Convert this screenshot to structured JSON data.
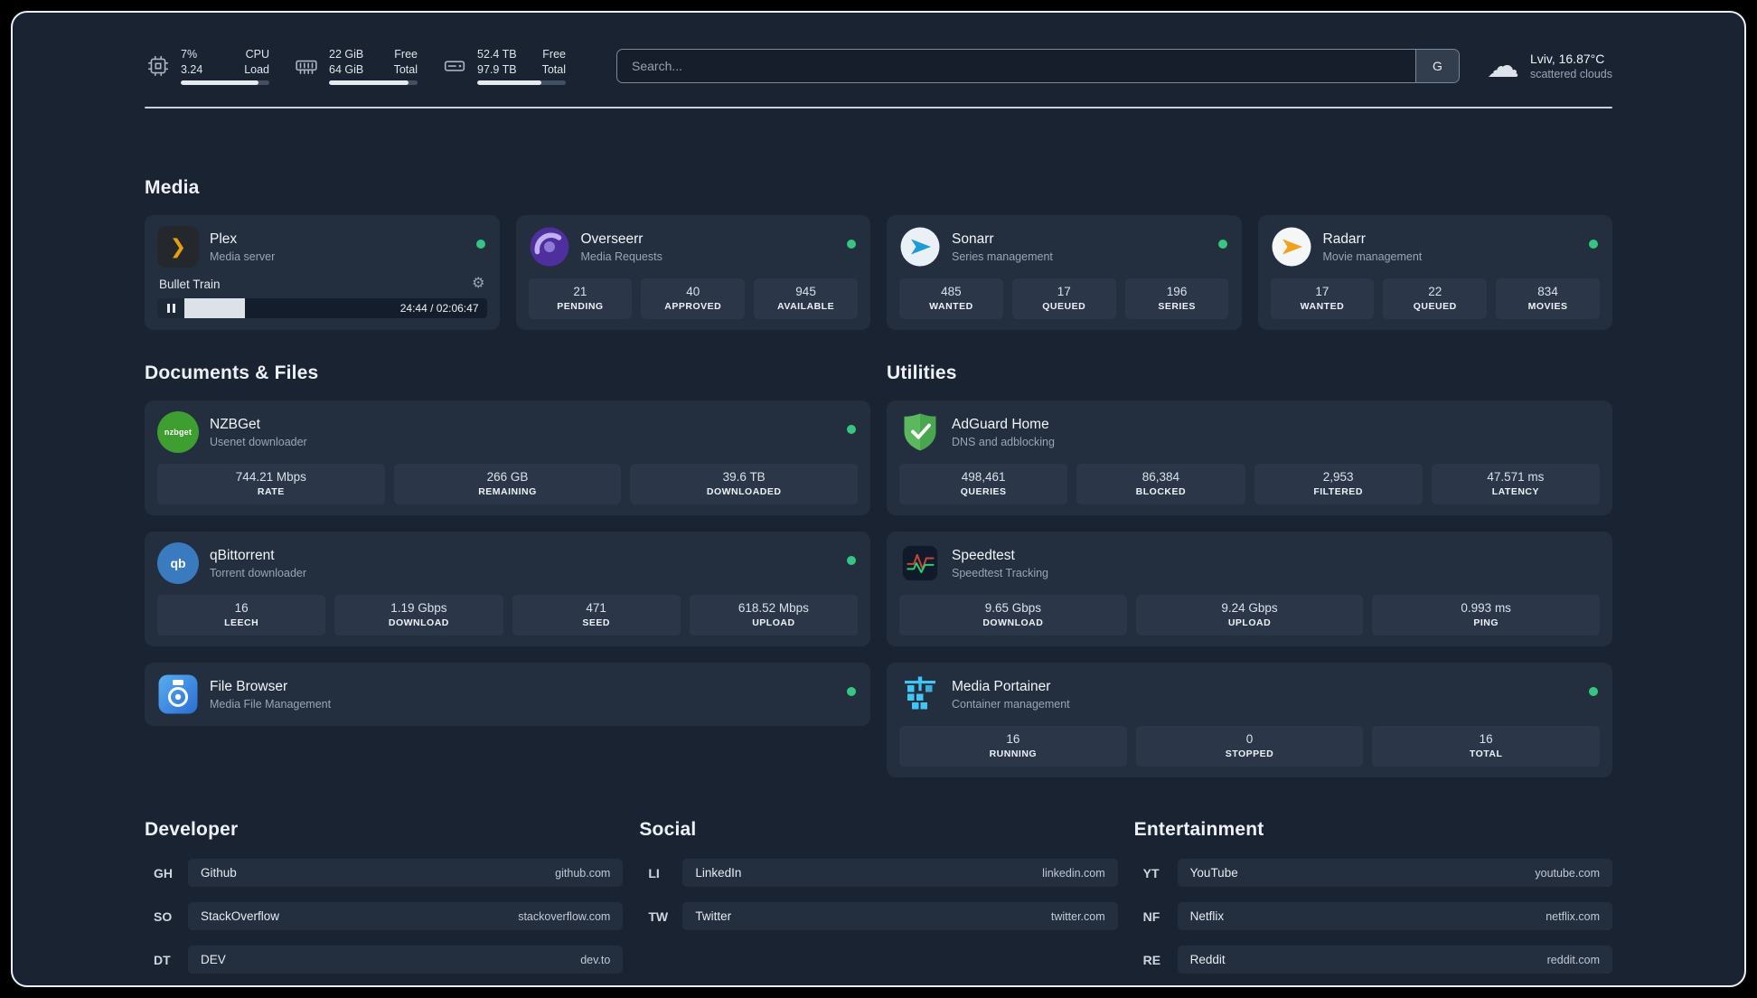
{
  "icons": {
    "plex_chevron": "❯",
    "gear": "⚙",
    "cloud": "☁"
  },
  "colors": {
    "background": "#1a2332",
    "card": "#232e3f",
    "stat_block": "#2b3748",
    "status_green": "#35c77f",
    "plex_gold": "#e5a00d"
  },
  "topbar": {
    "resources": [
      {
        "line1_value": "7%",
        "line1_label": "CPU",
        "line2_value": "3.24",
        "line2_label": "Load",
        "progress_pct": 88
      },
      {
        "line1_value": "22 GiB",
        "line1_label": "Free",
        "line2_value": "64 GiB",
        "line2_label": "Total",
        "progress_pct": 90
      },
      {
        "line1_value": "52.4 TB",
        "line1_label": "Free",
        "line2_value": "97.9 TB",
        "line2_label": "Total",
        "progress_pct": 72
      }
    ],
    "search": {
      "placeholder": "Search...",
      "provider_button": "G"
    },
    "weather": {
      "location": "Lviv, 16.87°C",
      "condition": "scattered clouds"
    }
  },
  "sections": {
    "media": {
      "title": "Media",
      "services": [
        {
          "name": "Plex",
          "description": "Media server",
          "status": "online",
          "player": {
            "track": "Bullet Train",
            "time_display": "24:44 / 02:06:47",
            "progress_pct": 20
          }
        },
        {
          "name": "Overseerr",
          "description": "Media Requests",
          "status": "online",
          "stats": [
            {
              "value": "21",
              "label": "PENDING"
            },
            {
              "value": "40",
              "label": "APPROVED"
            },
            {
              "value": "945",
              "label": "AVAILABLE"
            }
          ]
        },
        {
          "name": "Sonarr",
          "description": "Series management",
          "status": "online",
          "stats": [
            {
              "value": "485",
              "label": "WANTED"
            },
            {
              "value": "17",
              "label": "QUEUED"
            },
            {
              "value": "196",
              "label": "SERIES"
            }
          ]
        },
        {
          "name": "Radarr",
          "description": "Movie management",
          "status": "online",
          "stats": [
            {
              "value": "17",
              "label": "WANTED"
            },
            {
              "value": "22",
              "label": "QUEUED"
            },
            {
              "value": "834",
              "label": "MOVIES"
            }
          ]
        }
      ]
    },
    "documents": {
      "title": "Documents & Files",
      "services": [
        {
          "name": "NZBGet",
          "description": "Usenet downloader",
          "status": "online",
          "icon_text": "nzbget",
          "stats": [
            {
              "value": "744.21 Mbps",
              "label": "RATE"
            },
            {
              "value": "266 GB",
              "label": "REMAINING"
            },
            {
              "value": "39.6 TB",
              "label": "DOWNLOADED"
            }
          ]
        },
        {
          "name": "qBittorrent",
          "description": "Torrent downloader",
          "status": "online",
          "icon_text": "qb",
          "stats": [
            {
              "value": "16",
              "label": "LEECH"
            },
            {
              "value": "1.19 Gbps",
              "label": "DOWNLOAD"
            },
            {
              "value": "471",
              "label": "SEED"
            },
            {
              "value": "618.52 Mbps",
              "label": "UPLOAD"
            }
          ]
        },
        {
          "name": "File Browser",
          "description": "Media File Management",
          "status": "online",
          "stats": []
        }
      ]
    },
    "utilities": {
      "title": "Utilities",
      "services": [
        {
          "name": "AdGuard Home",
          "description": "DNS and adblocking",
          "stats": [
            {
              "value": "498,461",
              "label": "QUERIES"
            },
            {
              "value": "86,384",
              "label": "BLOCKED"
            },
            {
              "value": "2,953",
              "label": "FILTERED"
            },
            {
              "value": "47.571 ms",
              "label": "LATENCY"
            }
          ]
        },
        {
          "name": "Speedtest",
          "description": "Speedtest Tracking",
          "stats": [
            {
              "value": "9.65 Gbps",
              "label": "DOWNLOAD"
            },
            {
              "value": "9.24 Gbps",
              "label": "UPLOAD"
            },
            {
              "value": "0.993 ms",
              "label": "PING"
            }
          ]
        },
        {
          "name": "Media Portainer",
          "description": "Container management",
          "status": "online",
          "stats": [
            {
              "value": "16",
              "label": "RUNNING"
            },
            {
              "value": "0",
              "label": "STOPPED"
            },
            {
              "value": "16",
              "label": "TOTAL"
            }
          ]
        }
      ]
    },
    "bookmarks": [
      {
        "title": "Developer",
        "items": [
          {
            "abbr": "GH",
            "name": "Github",
            "url": "github.com"
          },
          {
            "abbr": "SO",
            "name": "StackOverflow",
            "url": "stackoverflow.com"
          },
          {
            "abbr": "DT",
            "name": "DEV",
            "url": "dev.to"
          }
        ]
      },
      {
        "title": "Social",
        "items": [
          {
            "abbr": "LI",
            "name": "LinkedIn",
            "url": "linkedin.com"
          },
          {
            "abbr": "TW",
            "name": "Twitter",
            "url": "twitter.com"
          }
        ]
      },
      {
        "title": "Entertainment",
        "items": [
          {
            "abbr": "YT",
            "name": "YouTube",
            "url": "youtube.com"
          },
          {
            "abbr": "NF",
            "name": "Netflix",
            "url": "netflix.com"
          },
          {
            "abbr": "RE",
            "name": "Reddit",
            "url": "reddit.com"
          }
        ]
      }
    ]
  }
}
